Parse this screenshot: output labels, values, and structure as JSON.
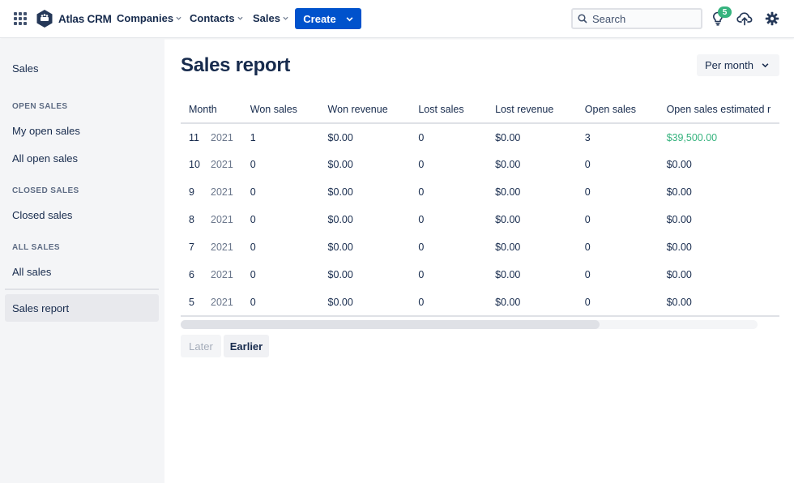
{
  "app": {
    "name": "Atlas CRM"
  },
  "nav": {
    "items": [
      {
        "label": "Companies"
      },
      {
        "label": "Contacts"
      },
      {
        "label": "Sales"
      }
    ],
    "create_label": "Create",
    "search_placeholder": "Search",
    "notification_count": "5"
  },
  "sidebar": {
    "title": "Sales",
    "groups": [
      {
        "heading": "OPEN SALES",
        "items": [
          "My open sales",
          "All open sales"
        ]
      },
      {
        "heading": "CLOSED SALES",
        "items": [
          "Closed sales"
        ]
      },
      {
        "heading": "ALL SALES",
        "items": [
          "All sales"
        ]
      }
    ],
    "active_item": "Sales report"
  },
  "main": {
    "title": "Sales report",
    "period_select": "Per month",
    "table": {
      "columns": [
        "Month",
        "Won sales",
        "Won revenue",
        "Lost sales",
        "Lost revenue",
        "Open sales",
        "Open sales estimated r"
      ],
      "rows": [
        {
          "month": "11",
          "year": "2021",
          "won": "1",
          "won_rev": "$0.00",
          "lost": "0",
          "lost_rev": "$0.00",
          "open": "3",
          "est": "$39,500.00"
        },
        {
          "month": "10",
          "year": "2021",
          "won": "0",
          "won_rev": "$0.00",
          "lost": "0",
          "lost_rev": "$0.00",
          "open": "0",
          "est": "$0.00"
        },
        {
          "month": "9",
          "year": "2021",
          "won": "0",
          "won_rev": "$0.00",
          "lost": "0",
          "lost_rev": "$0.00",
          "open": "0",
          "est": "$0.00"
        },
        {
          "month": "8",
          "year": "2021",
          "won": "0",
          "won_rev": "$0.00",
          "lost": "0",
          "lost_rev": "$0.00",
          "open": "0",
          "est": "$0.00"
        },
        {
          "month": "7",
          "year": "2021",
          "won": "0",
          "won_rev": "$0.00",
          "lost": "0",
          "lost_rev": "$0.00",
          "open": "0",
          "est": "$0.00"
        },
        {
          "month": "6",
          "year": "2021",
          "won": "0",
          "won_rev": "$0.00",
          "lost": "0",
          "lost_rev": "$0.00",
          "open": "0",
          "est": "$0.00"
        },
        {
          "month": "5",
          "year": "2021",
          "won": "0",
          "won_rev": "$0.00",
          "lost": "0",
          "lost_rev": "$0.00",
          "open": "0",
          "est": "$0.00"
        }
      ]
    },
    "pagination": {
      "later": "Later",
      "earlier": "Earlier"
    }
  },
  "colors": {
    "primary": "#0052cc",
    "positive": "#36b37e",
    "text": "#172b4d",
    "sidebar_bg": "#f4f5f7"
  },
  "icons": [
    "app-grid-icon",
    "atlas-logo-icon",
    "chevron-down-icon",
    "search-icon",
    "lightbulb-icon",
    "cloud-upload-icon",
    "gear-icon"
  ]
}
